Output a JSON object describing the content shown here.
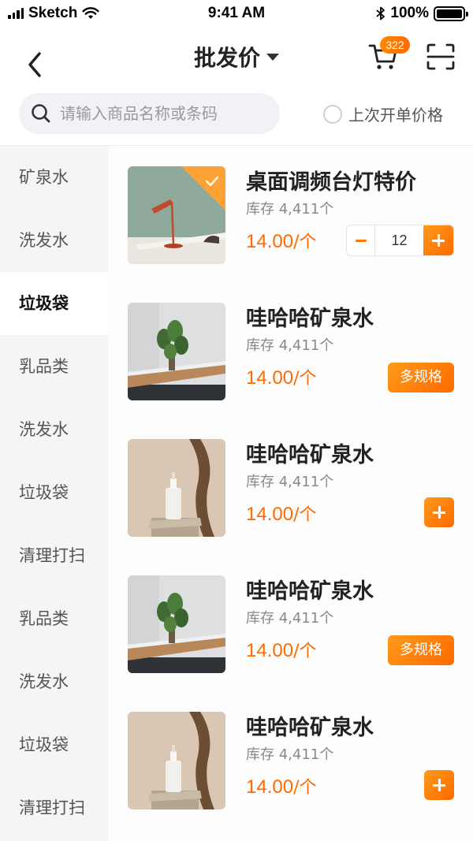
{
  "status_bar": {
    "carrier": "Sketch",
    "time": "9:41 AM",
    "battery": "100%"
  },
  "nav": {
    "title": "批发价",
    "cart_count": "322"
  },
  "search": {
    "placeholder": "请输入商品名称或条码",
    "last_price_label": "上次开单价格"
  },
  "sidebar": {
    "items": [
      {
        "label": "矿泉水"
      },
      {
        "label": "洗发水"
      },
      {
        "label": "垃圾袋",
        "active": true
      },
      {
        "label": "乳品类"
      },
      {
        "label": "洗发水"
      },
      {
        "label": "垃圾袋"
      },
      {
        "label": "清理打扫"
      },
      {
        "label": "乳品类"
      },
      {
        "label": "洗发水"
      },
      {
        "label": "垃圾袋"
      },
      {
        "label": "清理打扫"
      }
    ]
  },
  "products": [
    {
      "name": "桌面调频台灯特价",
      "stock": "库存 4,411个",
      "price": "14.00",
      "unit": "/个",
      "action": "stepper",
      "quantity": "12",
      "selected": true,
      "image": "desk-lamp"
    },
    {
      "name": "哇哈哈矿泉水",
      "stock": "库存 4,411个",
      "price": "14.00",
      "unit": "/个",
      "action": "spec",
      "spec_label": "多规格",
      "image": "plant-desk"
    },
    {
      "name": "哇哈哈矿泉水",
      "stock": "库存 4,411个",
      "price": "14.00",
      "unit": "/个",
      "action": "add",
      "image": "serum-bottle"
    },
    {
      "name": "哇哈哈矿泉水",
      "stock": "库存 4,411个",
      "price": "14.00",
      "unit": "/个",
      "action": "spec",
      "spec_label": "多规格",
      "image": "plant-desk"
    },
    {
      "name": "哇哈哈矿泉水",
      "stock": "库存 4,411个",
      "price": "14.00",
      "unit": "/个",
      "action": "add",
      "image": "serum-bottle"
    }
  ],
  "colors": {
    "accent": "#ff7a00",
    "sidebar_bg": "#f4f5f7",
    "search_bg": "#f1f2f5"
  }
}
